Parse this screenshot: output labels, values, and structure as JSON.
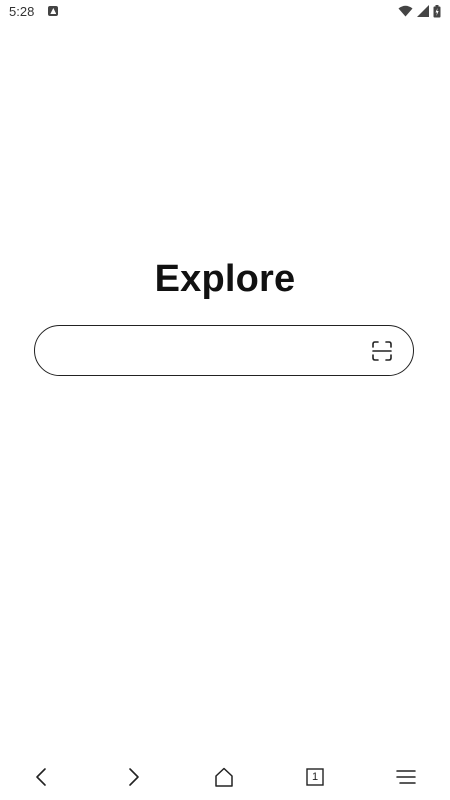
{
  "status": {
    "time": "5:28",
    "notification_icon": "notification-a-icon"
  },
  "main": {
    "title": "Explore",
    "search": {
      "value": "",
      "placeholder": ""
    }
  },
  "nav": {
    "tab_count": "1"
  }
}
